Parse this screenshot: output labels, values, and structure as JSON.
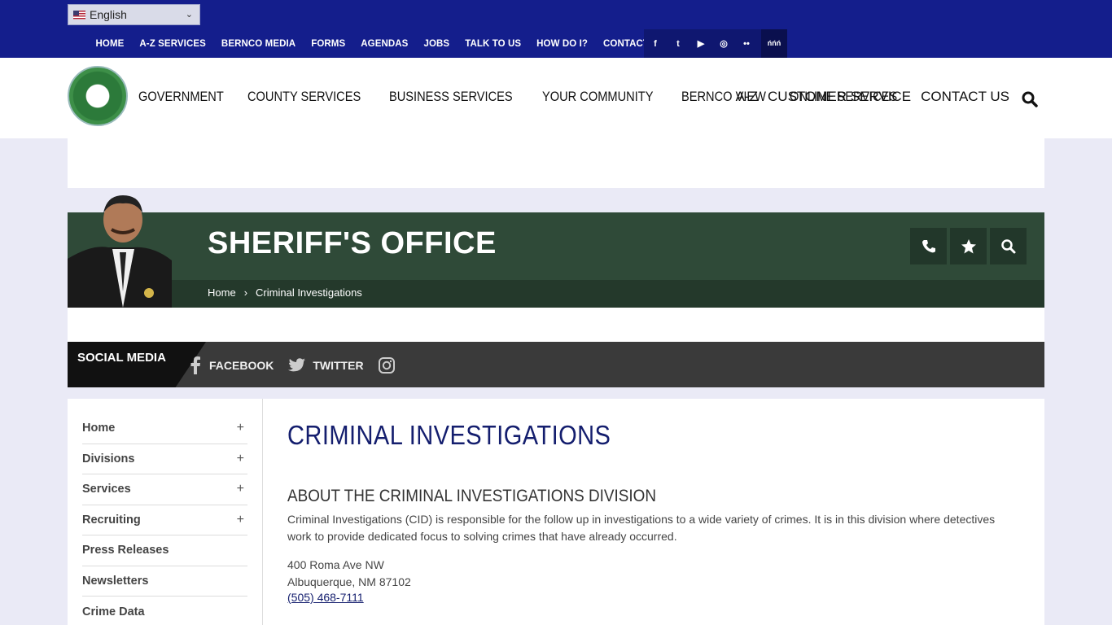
{
  "language": {
    "selected": "English"
  },
  "util_nav": [
    "HOME",
    "A-Z SERVICES",
    "BERNCO MEDIA",
    "FORMS",
    "AGENDAS",
    "JOBS",
    "TALK TO US",
    "HOW DO I?",
    "CONTACT US"
  ],
  "social_icons": [
    "facebook-icon",
    "twitter-icon",
    "youtube-icon",
    "instagram-icon",
    "flickr-icon",
    "nextdoor-icon"
  ],
  "social_glyphs": [
    "f",
    "t",
    "▶",
    "◎",
    "••",
    "ńńń"
  ],
  "main_nav": [
    "GOVERNMENT",
    "COUNTY SERVICES",
    "BUSINESS SERVICES",
    "YOUR COMMUNITY",
    "BERNCO VIEW",
    "ONLINE SERVICES"
  ],
  "right_nav": [
    "A-Z",
    "CUSTOMER SERVICE",
    "CONTACT US"
  ],
  "banner": {
    "title": "SHERIFF'S OFFICE",
    "breadcrumb": [
      "Home",
      "Criminal Investigations"
    ]
  },
  "social_media": {
    "label": "SOCIAL MEDIA",
    "items": [
      "FACEBOOK",
      "TWITTER"
    ]
  },
  "sidebar": [
    {
      "label": "Home",
      "expandable": true
    },
    {
      "label": "Divisions",
      "expandable": true
    },
    {
      "label": "Services",
      "expandable": true
    },
    {
      "label": "Recruiting",
      "expandable": true
    },
    {
      "label": "Press Releases",
      "expandable": false
    },
    {
      "label": "Newsletters",
      "expandable": false
    },
    {
      "label": "Crime Data",
      "expandable": false
    }
  ],
  "main": {
    "title": "CRIMINAL INVESTIGATIONS",
    "section_heading": "ABOUT THE CRIMINAL INVESTIGATIONS DIVISION",
    "description": "Criminal Investigations (CID) is responsible for the follow up in investigations to a wide variety of crimes. It is in this division where detectives work to provide dedicated focus to solving crimes that have already occurred.",
    "address_line1": "400 Roma Ave NW",
    "address_line2": "Albuquerque, NM 87102",
    "phone": "(505) 468-7111"
  },
  "colors": {
    "top": "#141e8c",
    "banner": "#2f4a38",
    "heading": "#141e6e"
  }
}
